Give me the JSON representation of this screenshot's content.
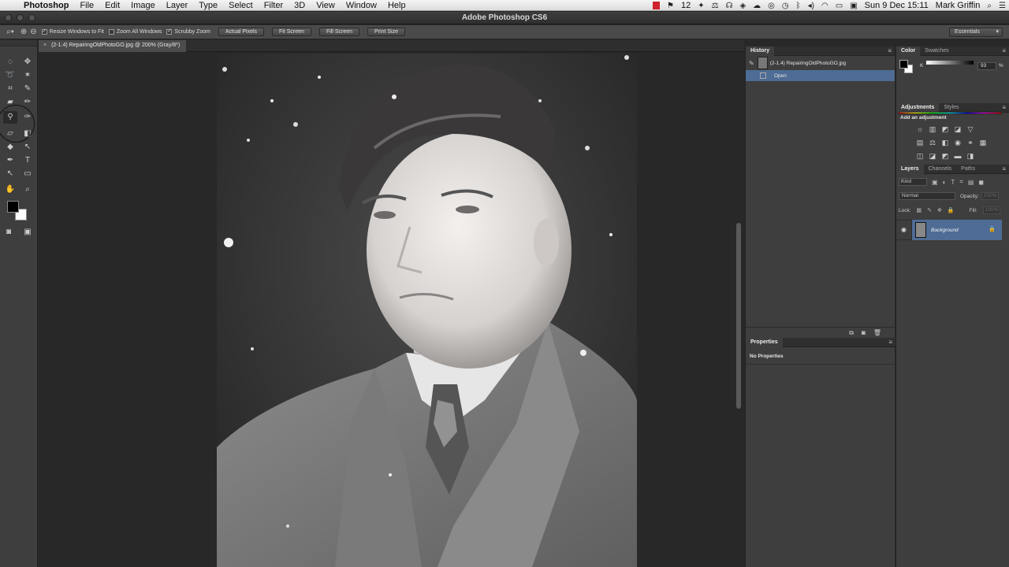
{
  "menubar": {
    "apple_glyph": "",
    "items": [
      "Photoshop",
      "File",
      "Edit",
      "Image",
      "Layer",
      "Type",
      "Select",
      "Filter",
      "3D",
      "View",
      "Window",
      "Help"
    ],
    "status": {
      "badge_count": "12",
      "date_time": "Sun 9 Dec  15:11",
      "user": "Mark Griffin"
    }
  },
  "window": {
    "title": "Adobe Photoshop CS6"
  },
  "options_bar": {
    "resize_windows": "Resize Windows to Fit",
    "zoom_all": "Zoom All Windows",
    "scrubby_zoom": "Scrubby Zoom",
    "actual_pixels": "Actual Pixels",
    "fit_screen": "Fit Screen",
    "fill_screen": "Fill Screen",
    "print_size": "Print Size",
    "workspace": "Essentials"
  },
  "document": {
    "tab_title": "(2-1.4) RepairingOldPhotoGO.jpg @ 200% (Gray/8*)",
    "close_glyph": "×"
  },
  "history": {
    "tab": "History",
    "snapshot_label": "(2-1.4) RepairingOldPhotoGO.jpg",
    "states": [
      "Open"
    ]
  },
  "properties": {
    "tab": "Properties",
    "empty_text": "No Properties"
  },
  "color_panel": {
    "tabs": [
      "Color",
      "Swatches"
    ],
    "channel": "K",
    "value": "93",
    "unit": "%",
    "foreground": "#000000",
    "background": "#ffffff"
  },
  "adjustments": {
    "tabs": [
      "Adjustments",
      "Styles"
    ],
    "title": "Add an adjustment"
  },
  "layers": {
    "tabs": [
      "Layers",
      "Channels",
      "Paths"
    ],
    "filter_kind": "Kind",
    "blend_mode": "Normal",
    "opacity_label": "Opacity:",
    "opacity_value": "100%",
    "lock_label": "Lock:",
    "fill_label": "Fill:",
    "fill_value": "100%",
    "items": [
      {
        "name": "Background"
      }
    ]
  },
  "colors": {
    "selection": "#4e6c95",
    "panel": "#3e3e3e",
    "workspace": "#282828"
  }
}
